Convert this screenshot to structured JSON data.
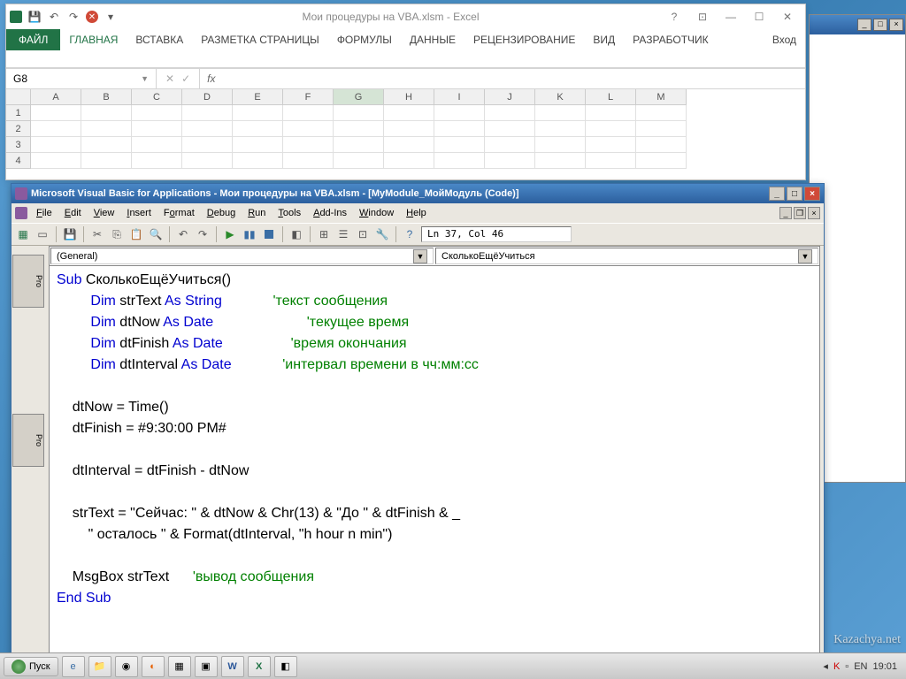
{
  "excel": {
    "title": "Мои процедуры на VBA.xlsm - Excel",
    "ribbon": {
      "file": "ФАЙЛ",
      "tabs": [
        "ГЛАВНАЯ",
        "ВСТАВКА",
        "РАЗМЕТКА СТРАНИЦЫ",
        "ФОРМУЛЫ",
        "ДАННЫЕ",
        "РЕЦЕНЗИРОВАНИЕ",
        "ВИД",
        "РАЗРАБОТЧИК"
      ],
      "signin": "Вход"
    },
    "namebox": "G8",
    "fx": "fx",
    "columns": [
      "A",
      "B",
      "C",
      "D",
      "E",
      "F",
      "G",
      "H",
      "I",
      "J",
      "K",
      "L",
      "M"
    ],
    "rows": [
      "1",
      "2",
      "3",
      "4"
    ],
    "active_col": "G"
  },
  "vba": {
    "title": "Microsoft Visual Basic for Applications - Мои процедуры на VBA.xlsm - [MyModule_МойМодуль (Code)]",
    "menus": [
      "File",
      "Edit",
      "View",
      "Insert",
      "Format",
      "Debug",
      "Run",
      "Tools",
      "Add-Ins",
      "Window",
      "Help"
    ],
    "cursor": "Ln 37, Col 46",
    "dd_left": "(General)",
    "dd_right": "СколькоЕщёУчиться",
    "code": {
      "l1_kw": "Sub",
      "l1_rest": " СколькоЕщёУчиться()",
      "l2_dim": "Dim",
      "l2_var": " strText ",
      "l2_as": "As String",
      "l2_cm": "'текст сообщения",
      "l3_dim": "Dim",
      "l3_var": " dtNow ",
      "l3_as": "As Date",
      "l3_cm": "'текущее время",
      "l4_dim": "Dim",
      "l4_var": " dtFinish ",
      "l4_as": "As Date",
      "l4_cm": "'время окончания",
      "l5_dim": "Dim",
      "l5_var": " dtInterval ",
      "l5_as": "As Date",
      "l5_cm": "'интервал времени в чч:мм:сс",
      "l7": "    dtNow = Time()",
      "l8": "    dtFinish = #9:30:00 PM#",
      "l10": "    dtInterval = dtFinish - dtNow",
      "l12": "    strText = \"Сейчас: \" & dtNow & Chr(13) & \"До \" & dtFinish & _",
      "l13": "        \" осталось \" & Format(dtInterval, \"h hour n min\")",
      "l15a": "    MsgBox strText      ",
      "l15_cm": "'вывод сообщения",
      "l16": "End Sub"
    }
  },
  "taskbar": {
    "start": "Пуск",
    "lang": "EN",
    "time": "19:01"
  },
  "watermark": "Kazachya.net"
}
